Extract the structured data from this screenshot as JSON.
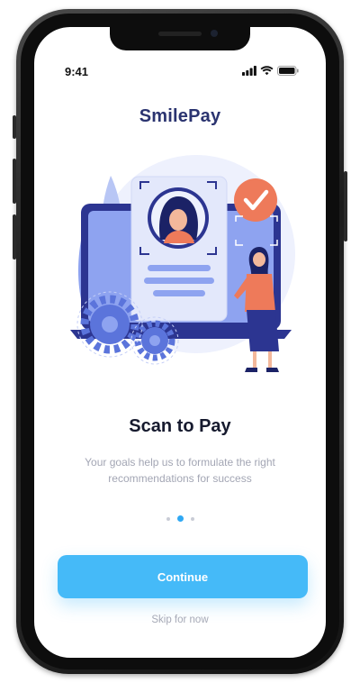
{
  "status_bar": {
    "time": "9:41",
    "icons": [
      "signal-icon",
      "wifi-icon",
      "battery-icon"
    ]
  },
  "app": {
    "title": "SmilePay"
  },
  "onboarding": {
    "illustration": "face-scan-illustration",
    "heading": "Scan to Pay",
    "description": "Your goals help us to formulate the right recommendations for success",
    "page_indicator": {
      "count": 3,
      "active_index": 1
    }
  },
  "actions": {
    "continue_label": "Continue",
    "skip_label": "Skip for now"
  },
  "colors": {
    "accent": "#45baf8",
    "title": "#2b3470",
    "heading": "#161a2e",
    "muted": "#a3a6b4",
    "illustration_blue": "#8ea3f0",
    "illustration_dark": "#2c3591",
    "illustration_orange": "#ee7a5a"
  }
}
